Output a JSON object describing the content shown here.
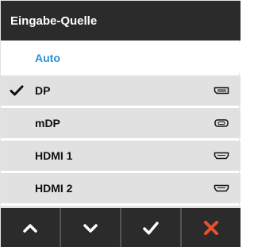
{
  "header": {
    "title": "Eingabe-Quelle"
  },
  "list": {
    "items": [
      {
        "label": "Auto"
      },
      {
        "label": "DP",
        "selected": true,
        "port_icon": "displayport-icon"
      },
      {
        "label": "mDP",
        "port_icon": "mini-displayport-icon"
      },
      {
        "label": "HDMI 1",
        "port_icon": "hdmi-icon"
      },
      {
        "label": "HDMI 2",
        "port_icon": "hdmi-icon"
      }
    ]
  },
  "toolbar": {
    "buttons": [
      {
        "icon": "chevron-up-icon"
      },
      {
        "icon": "chevron-down-icon"
      },
      {
        "icon": "checkmark-icon"
      },
      {
        "icon": "close-icon"
      }
    ]
  },
  "colors": {
    "header_bg": "#2b2b2b",
    "row_bg": "#e1e1e1",
    "accent_blue": "#2a8fd8",
    "close_red": "#e8502f"
  }
}
